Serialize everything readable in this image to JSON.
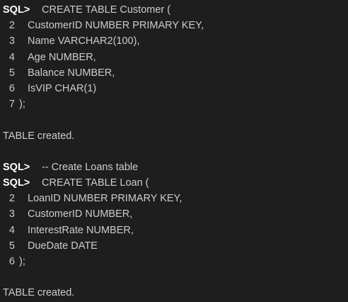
{
  "terminal": {
    "prompt": "SQL>",
    "block1": {
      "cmd": "CREATE TABLE Customer (",
      "lines": [
        {
          "n": "2",
          "text": "CustomerID NUMBER PRIMARY KEY,"
        },
        {
          "n": "3",
          "text": "Name VARCHAR2(100),"
        },
        {
          "n": "4",
          "text": "Age NUMBER,"
        },
        {
          "n": "5",
          "text": "Balance NUMBER,"
        },
        {
          "n": "6",
          "text": "IsVIP CHAR(1)"
        },
        {
          "n": "7",
          "text": ");"
        }
      ],
      "result": "TABLE created."
    },
    "comment": "-- Create Loans table",
    "block2": {
      "cmd": "CREATE TABLE Loan (",
      "lines": [
        {
          "n": "2",
          "text": "LoanID NUMBER PRIMARY KEY,"
        },
        {
          "n": "3",
          "text": "CustomerID NUMBER,"
        },
        {
          "n": "4",
          "text": "InterestRate NUMBER,"
        },
        {
          "n": "5",
          "text": "DueDate DATE"
        },
        {
          "n": "6",
          "text": ");"
        }
      ],
      "result": "TABLE created."
    }
  }
}
